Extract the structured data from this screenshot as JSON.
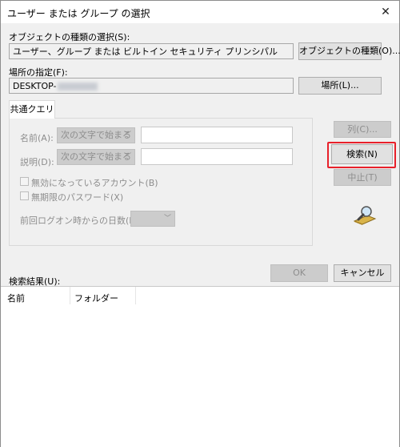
{
  "window": {
    "title": "ユーザー または グループ の選択",
    "close_glyph": "✕"
  },
  "object_types": {
    "label": "オブジェクトの種類の選択(S):",
    "value": "ユーザー、グループ または ビルトイン セキュリティ プリンシパル",
    "button": "オブジェクトの種類(O)..."
  },
  "location": {
    "label": "場所の指定(F):",
    "value": "DESKTOP-",
    "button": "場所(L)..."
  },
  "common_query": {
    "tab_label": "共通クエリ",
    "name_label": "名前(A):",
    "name_mode": "次の文字で始まる",
    "desc_label": "説明(D):",
    "desc_mode": "次の文字で始まる",
    "disabled_accounts": "無効になっているアカウント(B)",
    "no_expire_password": "無期限のパスワード(X)",
    "last_logon_label": "前回ログオン時からの日数(I):"
  },
  "side_buttons": {
    "columns": "列(C)...",
    "search": "検索(N)",
    "stop": "中止(T)"
  },
  "footer": {
    "ok": "OK",
    "cancel": "キャンセル"
  },
  "results": {
    "label": "検索結果(U):",
    "columns": [
      "名前",
      "フォルダー"
    ]
  },
  "icons": {
    "search_icon": "magnifier-search-icon"
  },
  "colors": {
    "highlight": "#e8202a"
  }
}
